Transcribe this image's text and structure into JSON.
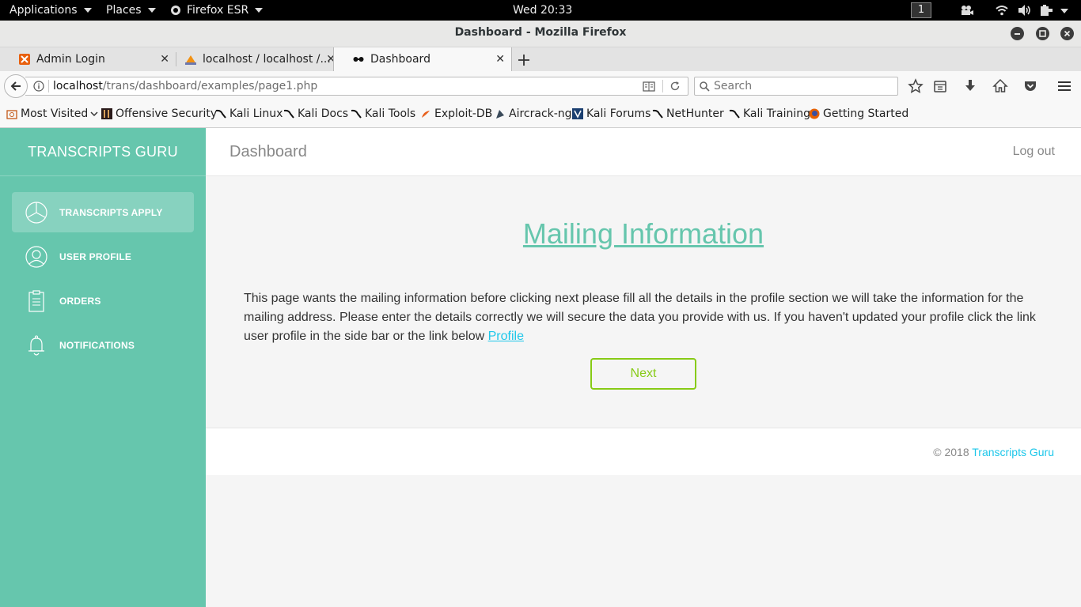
{
  "gnome_bar": {
    "applications": "Applications",
    "places": "Places",
    "firefox_menu": "Firefox ESR",
    "clock": "Wed 20:33",
    "workspace": "1"
  },
  "window": {
    "title": "Dashboard - Mozilla Firefox"
  },
  "tabs": [
    {
      "label": "Admin Login"
    },
    {
      "label": "localhost / localhost /..."
    },
    {
      "label": "Dashboard"
    }
  ],
  "navbar": {
    "url_host": "localhost",
    "url_path": "/trans/dashboard/examples/page1.php",
    "search_placeholder": "Search"
  },
  "bookmarks": [
    {
      "label": "Most Visited"
    },
    {
      "label": "Offensive Security"
    },
    {
      "label": "Kali Linux"
    },
    {
      "label": "Kali Docs"
    },
    {
      "label": "Kali Tools"
    },
    {
      "label": "Exploit-DB"
    },
    {
      "label": "Aircrack-ng"
    },
    {
      "label": "Kali Forums"
    },
    {
      "label": "NetHunter"
    },
    {
      "label": "Kali Training"
    },
    {
      "label": "Getting Started"
    }
  ],
  "sidebar": {
    "brand": "TRANSCRIPTS GURU",
    "items": [
      {
        "label": "TRANSCRIPTS APPLY",
        "icon": "pie-chart-icon",
        "active": true
      },
      {
        "label": "USER PROFILE",
        "icon": "user-icon"
      },
      {
        "label": "ORDERS",
        "icon": "clipboard-icon"
      },
      {
        "label": "NOTIFICATIONS",
        "icon": "bell-icon"
      }
    ]
  },
  "header": {
    "title": "Dashboard",
    "logout": "Log out"
  },
  "main": {
    "heading": "Mailing Information",
    "paragraph": "This page wants the mailing information before clicking next please fill all the details in the profile section we will take the information for the mailing address. Please enter the details correctly we will secure the data you provide with us. If you haven't updated your profile click the link user profile in the side bar or the link below ",
    "profile_link": "Profile",
    "next_button": "Next"
  },
  "footer": {
    "copyright": "© 2018 ",
    "brand_link": "Transcripts Guru"
  },
  "colors": {
    "accent": "#66c6ad",
    "link": "#1dc7ea",
    "success": "#87cb16"
  }
}
